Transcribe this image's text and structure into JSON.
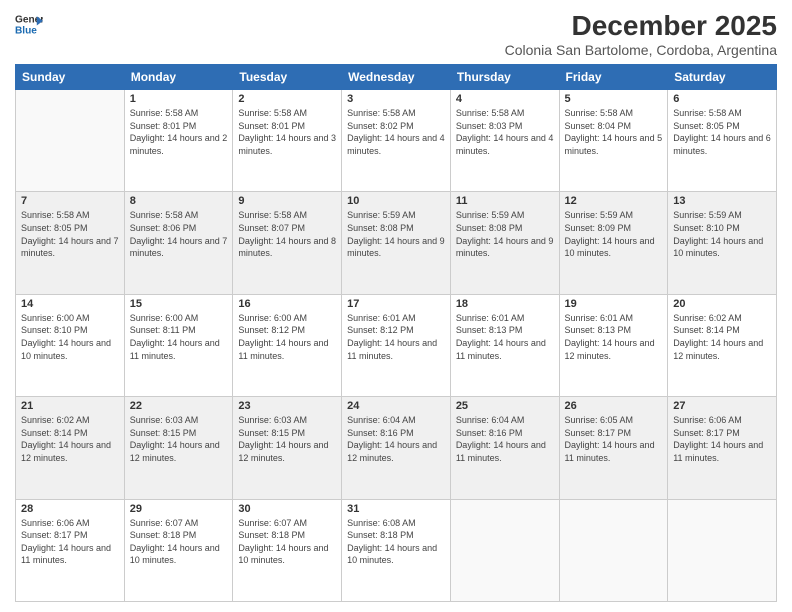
{
  "logo": {
    "line1": "General",
    "line2": "Blue"
  },
  "title": "December 2025",
  "subtitle": "Colonia San Bartolome, Cordoba, Argentina",
  "days_of_week": [
    "Sunday",
    "Monday",
    "Tuesday",
    "Wednesday",
    "Thursday",
    "Friday",
    "Saturday"
  ],
  "weeks": [
    [
      null,
      {
        "day": 1,
        "sunrise": "5:58 AM",
        "sunset": "8:01 PM",
        "daylight": "14 hours and 2 minutes."
      },
      {
        "day": 2,
        "sunrise": "5:58 AM",
        "sunset": "8:01 PM",
        "daylight": "14 hours and 3 minutes."
      },
      {
        "day": 3,
        "sunrise": "5:58 AM",
        "sunset": "8:02 PM",
        "daylight": "14 hours and 4 minutes."
      },
      {
        "day": 4,
        "sunrise": "5:58 AM",
        "sunset": "8:03 PM",
        "daylight": "14 hours and 4 minutes."
      },
      {
        "day": 5,
        "sunrise": "5:58 AM",
        "sunset": "8:04 PM",
        "daylight": "14 hours and 5 minutes."
      },
      {
        "day": 6,
        "sunrise": "5:58 AM",
        "sunset": "8:05 PM",
        "daylight": "14 hours and 6 minutes."
      }
    ],
    [
      {
        "day": 7,
        "sunrise": "5:58 AM",
        "sunset": "8:05 PM",
        "daylight": "14 hours and 7 minutes."
      },
      {
        "day": 8,
        "sunrise": "5:58 AM",
        "sunset": "8:06 PM",
        "daylight": "14 hours and 7 minutes."
      },
      {
        "day": 9,
        "sunrise": "5:58 AM",
        "sunset": "8:07 PM",
        "daylight": "14 hours and 8 minutes."
      },
      {
        "day": 10,
        "sunrise": "5:59 AM",
        "sunset": "8:08 PM",
        "daylight": "14 hours and 9 minutes."
      },
      {
        "day": 11,
        "sunrise": "5:59 AM",
        "sunset": "8:08 PM",
        "daylight": "14 hours and 9 minutes."
      },
      {
        "day": 12,
        "sunrise": "5:59 AM",
        "sunset": "8:09 PM",
        "daylight": "14 hours and 10 minutes."
      },
      {
        "day": 13,
        "sunrise": "5:59 AM",
        "sunset": "8:10 PM",
        "daylight": "14 hours and 10 minutes."
      }
    ],
    [
      {
        "day": 14,
        "sunrise": "6:00 AM",
        "sunset": "8:10 PM",
        "daylight": "14 hours and 10 minutes."
      },
      {
        "day": 15,
        "sunrise": "6:00 AM",
        "sunset": "8:11 PM",
        "daylight": "14 hours and 11 minutes."
      },
      {
        "day": 16,
        "sunrise": "6:00 AM",
        "sunset": "8:12 PM",
        "daylight": "14 hours and 11 minutes."
      },
      {
        "day": 17,
        "sunrise": "6:01 AM",
        "sunset": "8:12 PM",
        "daylight": "14 hours and 11 minutes."
      },
      {
        "day": 18,
        "sunrise": "6:01 AM",
        "sunset": "8:13 PM",
        "daylight": "14 hours and 11 minutes."
      },
      {
        "day": 19,
        "sunrise": "6:01 AM",
        "sunset": "8:13 PM",
        "daylight": "14 hours and 12 minutes."
      },
      {
        "day": 20,
        "sunrise": "6:02 AM",
        "sunset": "8:14 PM",
        "daylight": "14 hours and 12 minutes."
      }
    ],
    [
      {
        "day": 21,
        "sunrise": "6:02 AM",
        "sunset": "8:14 PM",
        "daylight": "14 hours and 12 minutes."
      },
      {
        "day": 22,
        "sunrise": "6:03 AM",
        "sunset": "8:15 PM",
        "daylight": "14 hours and 12 minutes."
      },
      {
        "day": 23,
        "sunrise": "6:03 AM",
        "sunset": "8:15 PM",
        "daylight": "14 hours and 12 minutes."
      },
      {
        "day": 24,
        "sunrise": "6:04 AM",
        "sunset": "8:16 PM",
        "daylight": "14 hours and 12 minutes."
      },
      {
        "day": 25,
        "sunrise": "6:04 AM",
        "sunset": "8:16 PM",
        "daylight": "14 hours and 11 minutes."
      },
      {
        "day": 26,
        "sunrise": "6:05 AM",
        "sunset": "8:17 PM",
        "daylight": "14 hours and 11 minutes."
      },
      {
        "day": 27,
        "sunrise": "6:06 AM",
        "sunset": "8:17 PM",
        "daylight": "14 hours and 11 minutes."
      }
    ],
    [
      {
        "day": 28,
        "sunrise": "6:06 AM",
        "sunset": "8:17 PM",
        "daylight": "14 hours and 11 minutes."
      },
      {
        "day": 29,
        "sunrise": "6:07 AM",
        "sunset": "8:18 PM",
        "daylight": "14 hours and 10 minutes."
      },
      {
        "day": 30,
        "sunrise": "6:07 AM",
        "sunset": "8:18 PM",
        "daylight": "14 hours and 10 minutes."
      },
      {
        "day": 31,
        "sunrise": "6:08 AM",
        "sunset": "8:18 PM",
        "daylight": "14 hours and 10 minutes."
      },
      null,
      null,
      null
    ]
  ]
}
